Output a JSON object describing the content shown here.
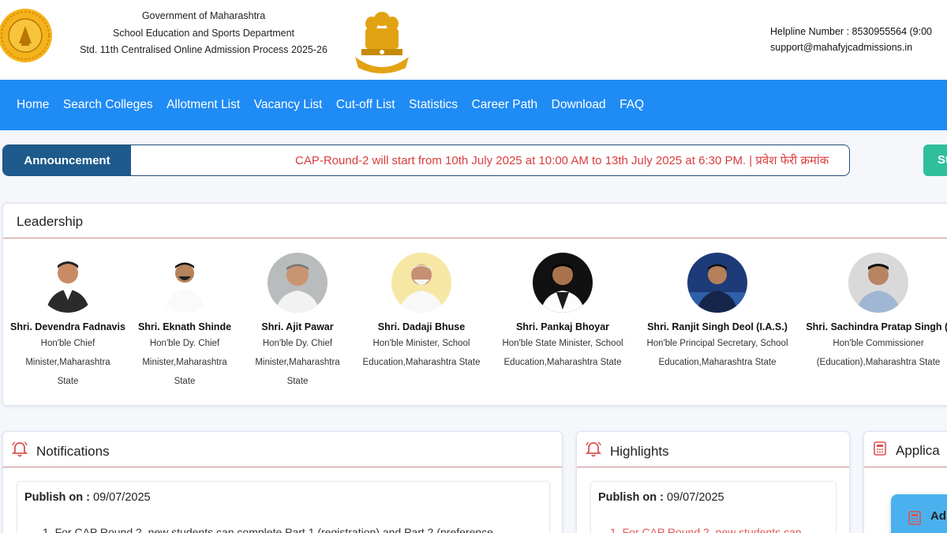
{
  "header": {
    "line1": "Government of Maharashtra",
    "line2": "School Education and Sports Department",
    "line3": "Std. 11th Centralised Online Admission Process 2025-26",
    "helpline": "Helpline Number : 8530955564 (9:00",
    "email": "support@mahafyjcadmissions.in",
    "left_logo_icon": "maharashtra-seal",
    "emblem_icon": "national-emblem"
  },
  "nav": {
    "items": [
      "Home",
      "Search Colleges",
      "Allotment List",
      "Vacancy List",
      "Cut-off List",
      "Statistics",
      "Career Path",
      "Download",
      "FAQ"
    ]
  },
  "announcement": {
    "label": "Announcement",
    "text": "CAP-Round-2 will start from 10th July 2025 at 10:00 AM to 13th July 2025 at 6:30 PM. | प्रवेश फेरी क्रमांक",
    "side_button": "St"
  },
  "leadership": {
    "title": "Leadership",
    "leaders": [
      {
        "name": "Shri. Devendra Fadnavis",
        "role1": "Hon'ble Chief",
        "role2": "Minister,Maharashtra",
        "role3": "State"
      },
      {
        "name": "Shri. Eknath Shinde",
        "role1": "Hon'ble Dy. Chief",
        "role2": "Minister,Maharashtra",
        "role3": "State"
      },
      {
        "name": "Shri. Ajit Pawar",
        "role1": "Hon'ble Dy. Chief",
        "role2": "Minister,Maharashtra",
        "role3": "State"
      },
      {
        "name": "Shri. Dadaji Bhuse",
        "role1": "Hon'ble Minister, School",
        "role2": "Education,Maharashtra State",
        "role3": ""
      },
      {
        "name": "Shri. Pankaj Bhoyar",
        "role1": "Hon'ble State Minister, School",
        "role2": "Education,Maharashtra State",
        "role3": ""
      },
      {
        "name": "Shri. Ranjit Singh Deol (I.A.S.)",
        "role1": "Hon'ble Principal Secretary, School",
        "role2": "Education,Maharashtra State",
        "role3": ""
      },
      {
        "name": "Shri. Sachindra Pratap Singh (I",
        "role1": "Hon'ble Commissioner",
        "role2": "(Education),Maharashtra State",
        "role3": ""
      }
    ]
  },
  "notifications": {
    "title": "Notifications",
    "publish_label": "Publish on :",
    "publish_date": "09/07/2025",
    "item": "1. For CAP Round 2, new students can complete Part 1 (registration) and Part 2 (preference"
  },
  "highlights": {
    "title": "Highlights",
    "publish_label": "Publish on :",
    "publish_date": "09/07/2025",
    "item": "1. For CAP Round 2, new students can"
  },
  "application": {
    "title": "Applica",
    "float_label": "Ad"
  },
  "colors": {
    "nav_bg": "#1f8bf5",
    "announcement_label_bg": "#1e5a8c",
    "announcement_text": "#d93e3e",
    "accent_green": "#2fbf9b",
    "title_underline": "#c88d8d"
  }
}
